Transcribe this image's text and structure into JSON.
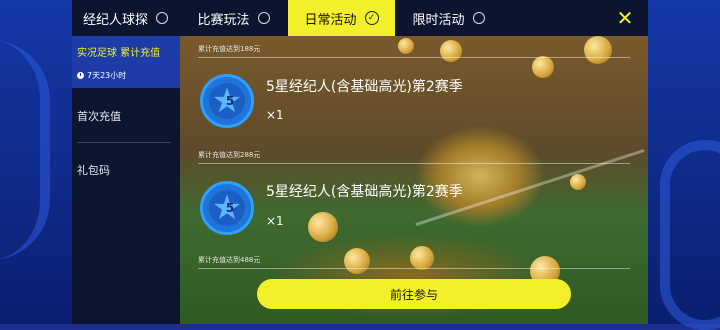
{
  "tabs": [
    {
      "label": "经纪人球探",
      "active": false
    },
    {
      "label": "比赛玩法",
      "active": false
    },
    {
      "label": "日常活动",
      "active": true
    },
    {
      "label": "限时活动",
      "active": false
    }
  ],
  "close_icon": "x-icon",
  "sidebar": {
    "active_item": {
      "label": "实况足球 累计充值",
      "timer": "7天23小时"
    },
    "items": [
      {
        "label": "首次充值"
      },
      {
        "label": "礼包码"
      }
    ]
  },
  "rewards": [
    {
      "condition": "累计充值达到188元",
      "badge_number": "5",
      "name": "5星经纪人(含基础高光)第2赛季",
      "quantity": "×1"
    },
    {
      "condition": "累计充值达到288元",
      "badge_number": "5",
      "name": "5星经纪人(含基础高光)第2赛季",
      "quantity": "×1"
    },
    {
      "condition": "累计充值达到488元"
    }
  ],
  "action_button": {
    "label": "前往参与"
  },
  "colors": {
    "accent": "#f3ef2a",
    "panel": "#0e1530",
    "active_side": "#1e3ca8",
    "badge": "#1f73d9"
  }
}
